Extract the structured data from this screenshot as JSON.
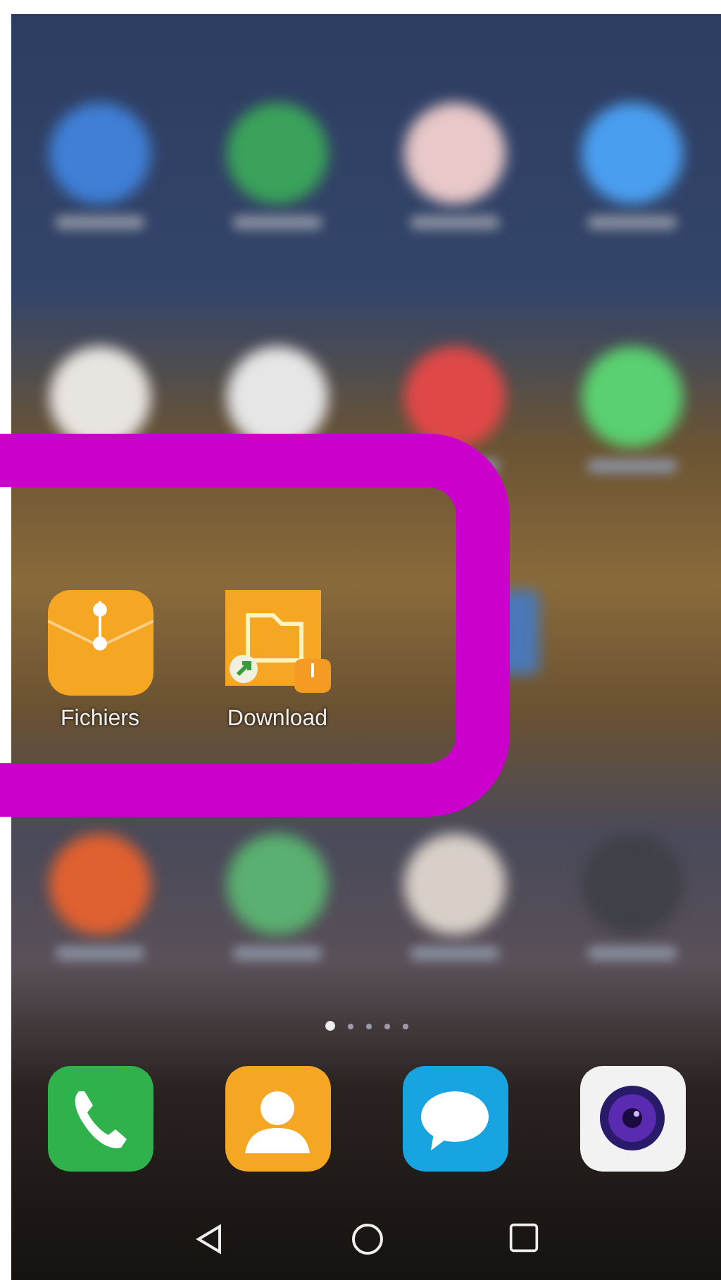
{
  "home_screen": {
    "blurred_rows": [
      [
        {
          "color": "#3f7fd6"
        },
        {
          "color": "#3aa25a"
        },
        {
          "color": "#e8c8c8"
        },
        {
          "color": "#4a9ef0"
        }
      ],
      [
        {
          "color": "#e8e4e0"
        },
        {
          "color": "#e6e6e6"
        },
        {
          "color": "#e04848"
        },
        {
          "color": "#5ad070"
        }
      ]
    ],
    "apps": [
      {
        "label": "Fichiers",
        "kind": "files"
      },
      {
        "label": "Download",
        "kind": "folder-shortcut"
      }
    ],
    "blurred_rows_after": [
      [
        {
          "color": "#e06030"
        },
        {
          "color": "#5ab070"
        },
        {
          "color": "#d8d0c8"
        },
        {
          "color": "#404048"
        }
      ]
    ]
  },
  "page_indicator": [
    {
      "selected": true
    },
    {
      "selected": false
    },
    {
      "selected": false
    },
    {
      "selected": false
    },
    {
      "selected": false
    }
  ],
  "dock": [
    {
      "kind": "phone"
    },
    {
      "kind": "contacts"
    },
    {
      "kind": "messages"
    },
    {
      "kind": "camera"
    }
  ]
}
